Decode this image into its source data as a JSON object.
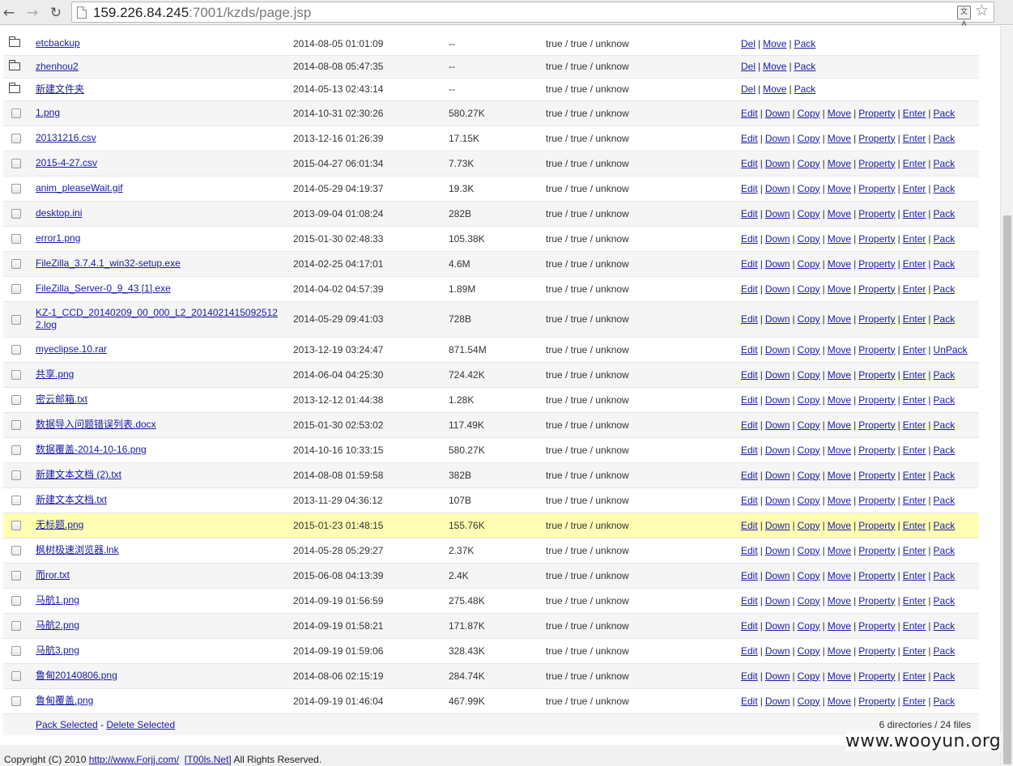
{
  "browser": {
    "url_host": "159.226.84.245",
    "url_rest": ":7001/kzds/page.jsp"
  },
  "directories": [
    {
      "name": "etcbackup",
      "time": "2014-08-05 01:01:09",
      "size": "--",
      "perm": "true / true / unknow",
      "actions": [
        "Del",
        "Move",
        "Pack"
      ]
    },
    {
      "name": "zhenhou2",
      "time": "2014-08-08 05:47:35",
      "size": "--",
      "perm": "true / true / unknow",
      "actions": [
        "Del",
        "Move",
        "Pack"
      ]
    },
    {
      "name": "新建文件夹",
      "time": "2014-05-13 02:43:14",
      "size": "--",
      "perm": "true / true / unknow",
      "actions": [
        "Del",
        "Move",
        "Pack"
      ]
    }
  ],
  "files": [
    {
      "name": "1.png",
      "time": "2014-10-31 02:30:26",
      "size": "580.27K",
      "perm": "true / true / unknow",
      "actions": [
        "Edit",
        "Down",
        "Copy",
        "Move",
        "Property",
        "Enter",
        "Pack"
      ]
    },
    {
      "name": "20131216.csv",
      "time": "2013-12-16 01:26:39",
      "size": "17.15K",
      "perm": "true / true / unknow",
      "actions": [
        "Edit",
        "Down",
        "Copy",
        "Move",
        "Property",
        "Enter",
        "Pack"
      ]
    },
    {
      "name": "2015-4-27.csv",
      "time": "2015-04-27 06:01:34",
      "size": "7.73K",
      "perm": "true / true / unknow",
      "actions": [
        "Edit",
        "Down",
        "Copy",
        "Move",
        "Property",
        "Enter",
        "Pack"
      ]
    },
    {
      "name": "anim_pleaseWait.gif",
      "time": "2014-05-29 04:19:37",
      "size": "19.3K",
      "perm": "true / true / unknow",
      "actions": [
        "Edit",
        "Down",
        "Copy",
        "Move",
        "Property",
        "Enter",
        "Pack"
      ]
    },
    {
      "name": "desktop.ini",
      "time": "2013-09-04 01:08:24",
      "size": "282B",
      "perm": "true / true / unknow",
      "actions": [
        "Edit",
        "Down",
        "Copy",
        "Move",
        "Property",
        "Enter",
        "Pack"
      ]
    },
    {
      "name": "error1.png",
      "time": "2015-01-30 02:48:33",
      "size": "105.38K",
      "perm": "true / true / unknow",
      "actions": [
        "Edit",
        "Down",
        "Copy",
        "Move",
        "Property",
        "Enter",
        "Pack"
      ]
    },
    {
      "name": "FileZilla_3.7.4.1_win32-setup.exe",
      "time": "2014-02-25 04:17:01",
      "size": "4.6M",
      "perm": "true / true / unknow",
      "actions": [
        "Edit",
        "Down",
        "Copy",
        "Move",
        "Property",
        "Enter",
        "Pack"
      ]
    },
    {
      "name": "FileZilla_Server-0_9_43 [1].exe",
      "time": "2014-04-02 04:57:39",
      "size": "1.89M",
      "perm": "true / true / unknow",
      "actions": [
        "Edit",
        "Down",
        "Copy",
        "Move",
        "Property",
        "Enter",
        "Pack"
      ]
    },
    {
      "name": "KZ-1_CCD_20140209_00_000_L2_20140214150925122.log",
      "time": "2014-05-29 09:41:03",
      "size": "728B",
      "perm": "true / true / unknow",
      "actions": [
        "Edit",
        "Down",
        "Copy",
        "Move",
        "Property",
        "Enter",
        "Pack"
      ],
      "tall": true
    },
    {
      "name": "myeclipse.10.rar",
      "time": "2013-12-19 03:24:47",
      "size": "871.54M",
      "perm": "true / true / unknow",
      "actions": [
        "Edit",
        "Down",
        "Copy",
        "Move",
        "Property",
        "Enter",
        "UnPack"
      ]
    },
    {
      "name": "共享.png",
      "time": "2014-06-04 04:25:30",
      "size": "724.42K",
      "perm": "true / true / unknow",
      "actions": [
        "Edit",
        "Down",
        "Copy",
        "Move",
        "Property",
        "Enter",
        "Pack"
      ]
    },
    {
      "name": "密云邮箱.txt",
      "time": "2013-12-12 01:44:38",
      "size": "1.28K",
      "perm": "true / true / unknow",
      "actions": [
        "Edit",
        "Down",
        "Copy",
        "Move",
        "Property",
        "Enter",
        "Pack"
      ]
    },
    {
      "name": "数据导入问题错误列表.docx",
      "time": "2015-01-30 02:53:02",
      "size": "117.49K",
      "perm": "true / true / unknow",
      "actions": [
        "Edit",
        "Down",
        "Copy",
        "Move",
        "Property",
        "Enter",
        "Pack"
      ]
    },
    {
      "name": "数据覆盖-2014-10-16.png",
      "time": "2014-10-16 10:33:15",
      "size": "580.27K",
      "perm": "true / true / unknow",
      "actions": [
        "Edit",
        "Down",
        "Copy",
        "Move",
        "Property",
        "Enter",
        "Pack"
      ]
    },
    {
      "name": "新建文本文档 (2).txt",
      "time": "2014-08-08 01:59:58",
      "size": "382B",
      "perm": "true / true / unknow",
      "actions": [
        "Edit",
        "Down",
        "Copy",
        "Move",
        "Property",
        "Enter",
        "Pack"
      ]
    },
    {
      "name": "新建文本文档.txt",
      "time": "2013-11-29 04:36:12",
      "size": "107B",
      "perm": "true / true / unknow",
      "actions": [
        "Edit",
        "Down",
        "Copy",
        "Move",
        "Property",
        "Enter",
        "Pack"
      ]
    },
    {
      "name": "无标题.png",
      "time": "2015-01-23 01:48:15",
      "size": "155.76K",
      "perm": "true / true / unknow",
      "actions": [
        "Edit",
        "Down",
        "Copy",
        "Move",
        "Property",
        "Enter",
        "Pack"
      ],
      "highlight": true
    },
    {
      "name": "枫树极速浏览器.lnk",
      "time": "2014-05-28 05:29:27",
      "size": "2.37K",
      "perm": "true / true / unknow",
      "actions": [
        "Edit",
        "Down",
        "Copy",
        "Move",
        "Property",
        "Enter",
        "Pack"
      ]
    },
    {
      "name": "而ror.txt",
      "time": "2015-06-08 04:13:39",
      "size": "2.4K",
      "perm": "true / true / unknow",
      "actions": [
        "Edit",
        "Down",
        "Copy",
        "Move",
        "Property",
        "Enter",
        "Pack"
      ]
    },
    {
      "name": "马航1.png",
      "time": "2014-09-19 01:56:59",
      "size": "275.48K",
      "perm": "true / true / unknow",
      "actions": [
        "Edit",
        "Down",
        "Copy",
        "Move",
        "Property",
        "Enter",
        "Pack"
      ]
    },
    {
      "name": "马航2.png",
      "time": "2014-09-19 01:58:21",
      "size": "171.87K",
      "perm": "true / true / unknow",
      "actions": [
        "Edit",
        "Down",
        "Copy",
        "Move",
        "Property",
        "Enter",
        "Pack"
      ]
    },
    {
      "name": "马航3.png",
      "time": "2014-09-19 01:59:06",
      "size": "328.43K",
      "perm": "true / true / unknow",
      "actions": [
        "Edit",
        "Down",
        "Copy",
        "Move",
        "Property",
        "Enter",
        "Pack"
      ]
    },
    {
      "name": "鲁甸20140806.png",
      "time": "2014-08-06 02:15:19",
      "size": "284.74K",
      "perm": "true / true / unknow",
      "actions": [
        "Edit",
        "Down",
        "Copy",
        "Move",
        "Property",
        "Enter",
        "Pack"
      ]
    },
    {
      "name": "鲁甸覆盖.png",
      "time": "2014-09-19 01:46:04",
      "size": "467.99K",
      "perm": "true / true / unknow",
      "actions": [
        "Edit",
        "Down",
        "Copy",
        "Move",
        "Property",
        "Enter",
        "Pack"
      ]
    }
  ],
  "footer": {
    "pack_selected": "Pack Selected",
    "dash": " - ",
    "delete_selected": "Delete Selected",
    "count": "6 directories / 24 files"
  },
  "copyright": {
    "prefix": "Copyright (C) 2010 ",
    "link1": "http://www.Forjj.com/",
    "link2": "[T00ls.Net]",
    "suffix": " All Rights Reserved."
  },
  "watermark": "www.wooyun.org"
}
